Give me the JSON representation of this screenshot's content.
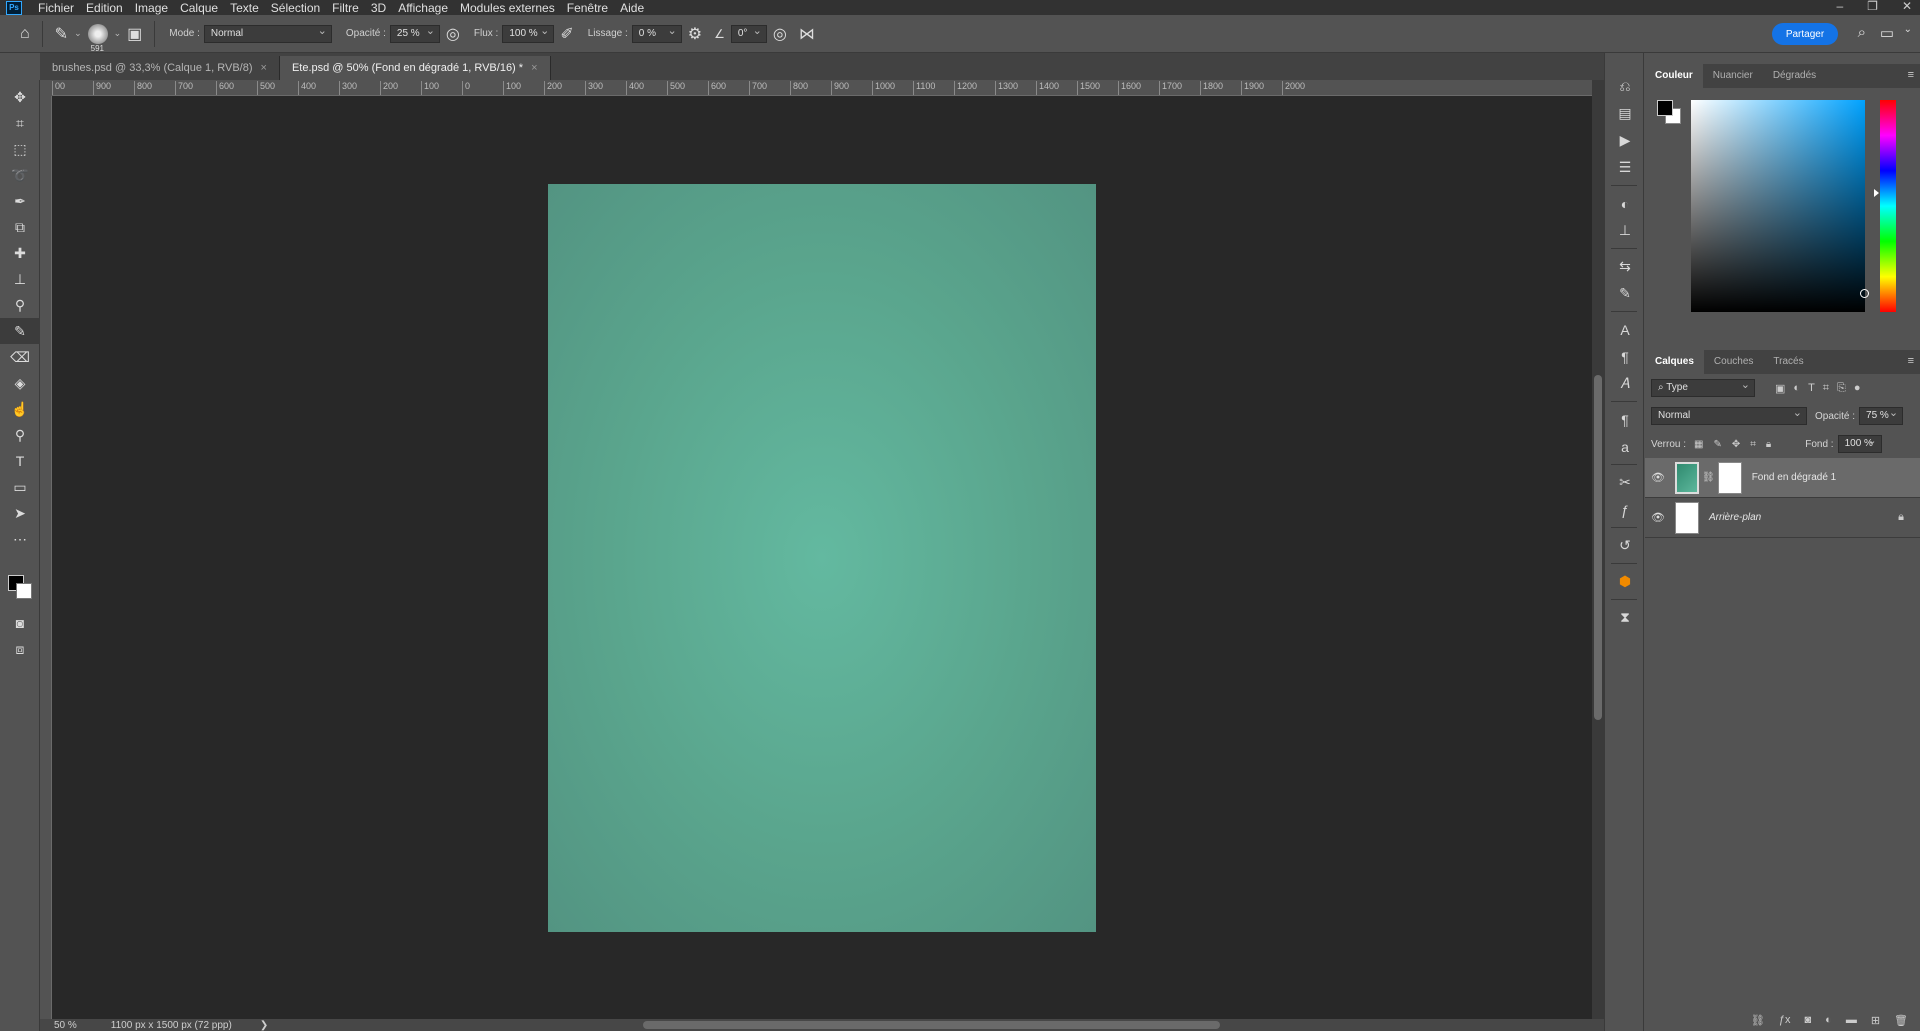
{
  "app": {
    "logo": "Ps"
  },
  "menu": [
    "Fichier",
    "Edition",
    "Image",
    "Calque",
    "Texte",
    "Sélection",
    "Filtre",
    "3D",
    "Affichage",
    "Modules externes",
    "Fenêtre",
    "Aide"
  ],
  "window_controls": {
    "minimize": "–",
    "restore": "❐",
    "close": "✕"
  },
  "options": {
    "brush_size": "591",
    "mode_label": "Mode :",
    "mode_value": "Normal",
    "opacity_label": "Opacité :",
    "opacity_value": "25 %",
    "flow_label": "Flux :",
    "flow_value": "100 %",
    "smoothing_label": "Lissage :",
    "smoothing_value": "0 %",
    "angle_value": "0°",
    "share_label": "Partager"
  },
  "tabs": [
    {
      "label": "brushes.psd @ 33,3% (Calque 1, RVB/8)",
      "close": "×"
    },
    {
      "label": "Ete.psd @ 50% (Fond en dégradé 1, RVB/16) *",
      "close": "×"
    }
  ],
  "ruler": [
    "00",
    "900",
    "800",
    "700",
    "600",
    "500",
    "400",
    "300",
    "200",
    "100",
    "0",
    "100",
    "200",
    "300",
    "400",
    "500",
    "600",
    "700",
    "800",
    "900",
    "1000",
    "1100",
    "1200",
    "1300",
    "1400",
    "1500",
    "1600",
    "1700",
    "1800",
    "1900",
    "2000"
  ],
  "status": {
    "zoom": "50 %",
    "doc_info": "1100 px x 1500 px (72 ppp)",
    "arrow": "❯"
  },
  "color_panel": {
    "tabs": [
      "Couleur",
      "Nuancier",
      "Dégradés"
    ],
    "fg": "#000000",
    "bg": "#ffffff"
  },
  "layers_panel": {
    "tabs": [
      "Calques",
      "Couches",
      "Tracés"
    ],
    "filter_value": "Type",
    "blend_value": "Normal",
    "opacity_label": "Opacité :",
    "opacity_value": "75 %",
    "lock_label": "Verrou :",
    "fill_label": "Fond :",
    "fill_value": "100 %",
    "layers": [
      {
        "name": "Fond en dégradé 1",
        "selected": true
      },
      {
        "name": "Arrière-plan",
        "selected": false
      }
    ]
  },
  "colors": {
    "canvas_bg": "#282828",
    "doc_center": "#63b9a0",
    "doc_edge": "#539482",
    "accent": "#1473e6"
  }
}
